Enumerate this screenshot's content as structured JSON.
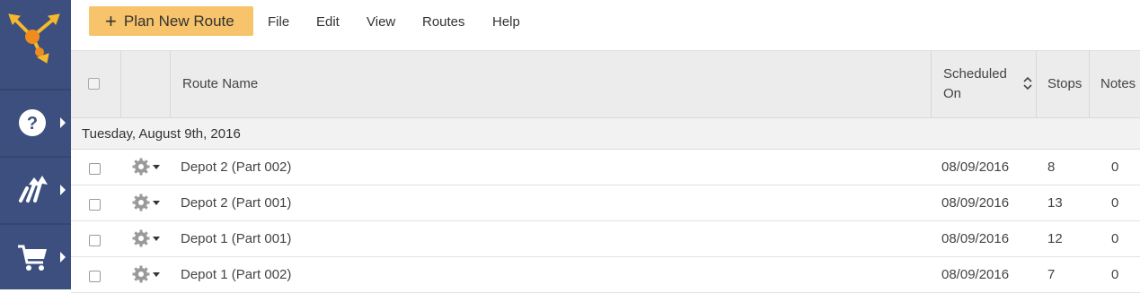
{
  "sidebar": {
    "items": [
      {
        "name": "help",
        "icon": "question-circle-icon"
      },
      {
        "name": "routes",
        "icon": "route-arrows-icon"
      },
      {
        "name": "cart",
        "icon": "shopping-cart-icon"
      }
    ]
  },
  "toolbar": {
    "plan_button": "Plan New Route",
    "menus": [
      "File",
      "Edit",
      "View",
      "Routes",
      "Help"
    ]
  },
  "table": {
    "headers": {
      "route_name": "Route Name",
      "scheduled_on_line1": "Scheduled",
      "scheduled_on_line2": "On",
      "stops": "Stops",
      "notes": "Notes"
    },
    "group_label": "Tuesday, August 9th, 2016",
    "rows": [
      {
        "name": "Depot 2 (Part 002)",
        "scheduled": "08/09/2016",
        "stops": "8",
        "notes": "0"
      },
      {
        "name": "Depot 2 (Part 001)",
        "scheduled": "08/09/2016",
        "stops": "13",
        "notes": "0"
      },
      {
        "name": "Depot 1 (Part 001)",
        "scheduled": "08/09/2016",
        "stops": "12",
        "notes": "0"
      },
      {
        "name": "Depot 1 (Part 002)",
        "scheduled": "08/09/2016",
        "stops": "7",
        "notes": "0"
      }
    ]
  },
  "colors": {
    "sidebar": "#3c4f7e",
    "button": "#f7c36b",
    "logo_orange": "#f08c1e",
    "logo_yellow": "#f5b82e"
  }
}
